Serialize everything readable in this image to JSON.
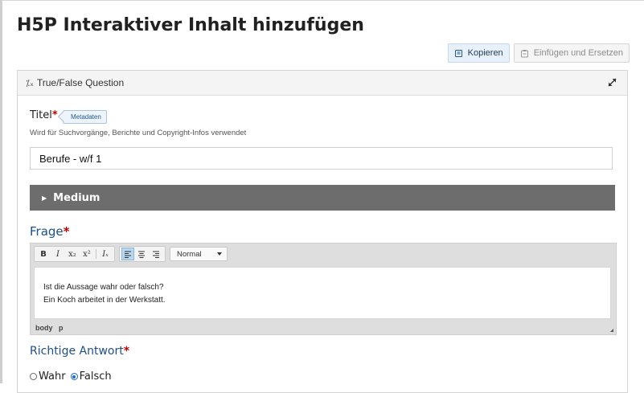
{
  "page": {
    "title": "H5P Interaktiver Inhalt hinzufügen"
  },
  "toolbar": {
    "copy_label": "Kopieren",
    "paste_label": "Einfügen und Ersetzen"
  },
  "panel": {
    "library_icon": "⁒ₓ",
    "library_title": "True/False Question",
    "expand_icon": "expand-icon"
  },
  "title_field": {
    "label": "Titel",
    "required_mark": "*",
    "metadata_button": "Metadaten",
    "description": "Wird für Suchvorgänge, Berichte und Copyright-Infos verwendet",
    "value": "Berufe - w/f 1"
  },
  "medium": {
    "caret": "▶",
    "label": "Medium"
  },
  "question": {
    "label": "Frage",
    "required_mark": "*",
    "toolbar": {
      "bold": "B",
      "italic": "I",
      "subscript": "x₂",
      "superscript": "x²",
      "remove_format": "Iₓ",
      "format_value": "Normal"
    },
    "content_lines": [
      "Ist die Aussage wahr oder falsch?",
      "Ein Koch arbeitet in der Werkstatt."
    ],
    "path": [
      "body",
      "p"
    ]
  },
  "answer": {
    "label": "Richtige Antwort",
    "required_mark": "*",
    "options": [
      {
        "label": "Wahr",
        "checked": false
      },
      {
        "label": "Falsch",
        "checked": true
      }
    ]
  },
  "colors": {
    "accent_label": "#1d4f88",
    "required": "#c00000",
    "medium_bar": "#6d6d6d",
    "radio_selected": "#1b6ad1"
  }
}
